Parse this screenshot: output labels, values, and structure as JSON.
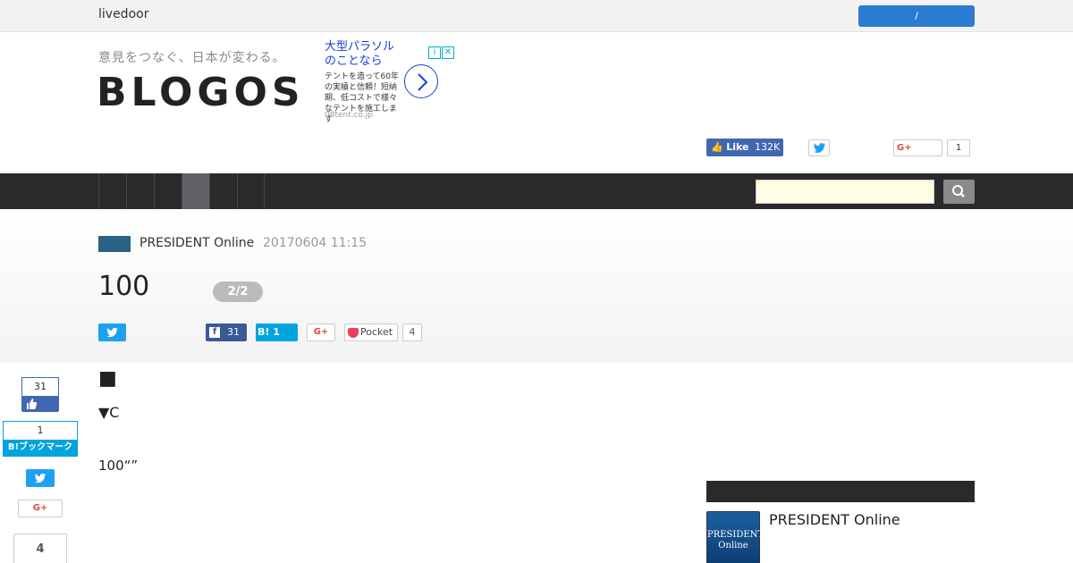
{
  "topbar": {
    "brand": "livedoor",
    "login_label": "/"
  },
  "header": {
    "tagline": "意見をつなぐ、日本が変わる。",
    "logo": "BLOGOS"
  },
  "ad": {
    "title": "大型パラソルのことなら",
    "body": "テントを造って60年の実績と信頼！短納期、低コストで様々なテントを施工します",
    "url": "08tent.co.jp"
  },
  "header_share": {
    "fb_like_label": "Like",
    "fb_like_count": "132K",
    "gplus_count": "1"
  },
  "search": {
    "placeholder": ""
  },
  "article": {
    "author": "PRESIDENT Online",
    "date": "20170604 11:15",
    "title": "100",
    "page_indicator": "2/2",
    "share": {
      "fb_count": "31",
      "hatena_count": "1",
      "pocket_label": "Pocket",
      "pocket_count": "4"
    },
    "square": "■",
    "sub_heading": "▼C",
    "paragraph": "100“”"
  },
  "side_share": {
    "fb_count": "31",
    "hatena_count": "1",
    "hatena_label": "B!ブックマーク",
    "pocket_count": "4"
  },
  "sidebar": {
    "avatar_text": "PRESIDENT Online",
    "author": "PRESIDENT Online"
  }
}
